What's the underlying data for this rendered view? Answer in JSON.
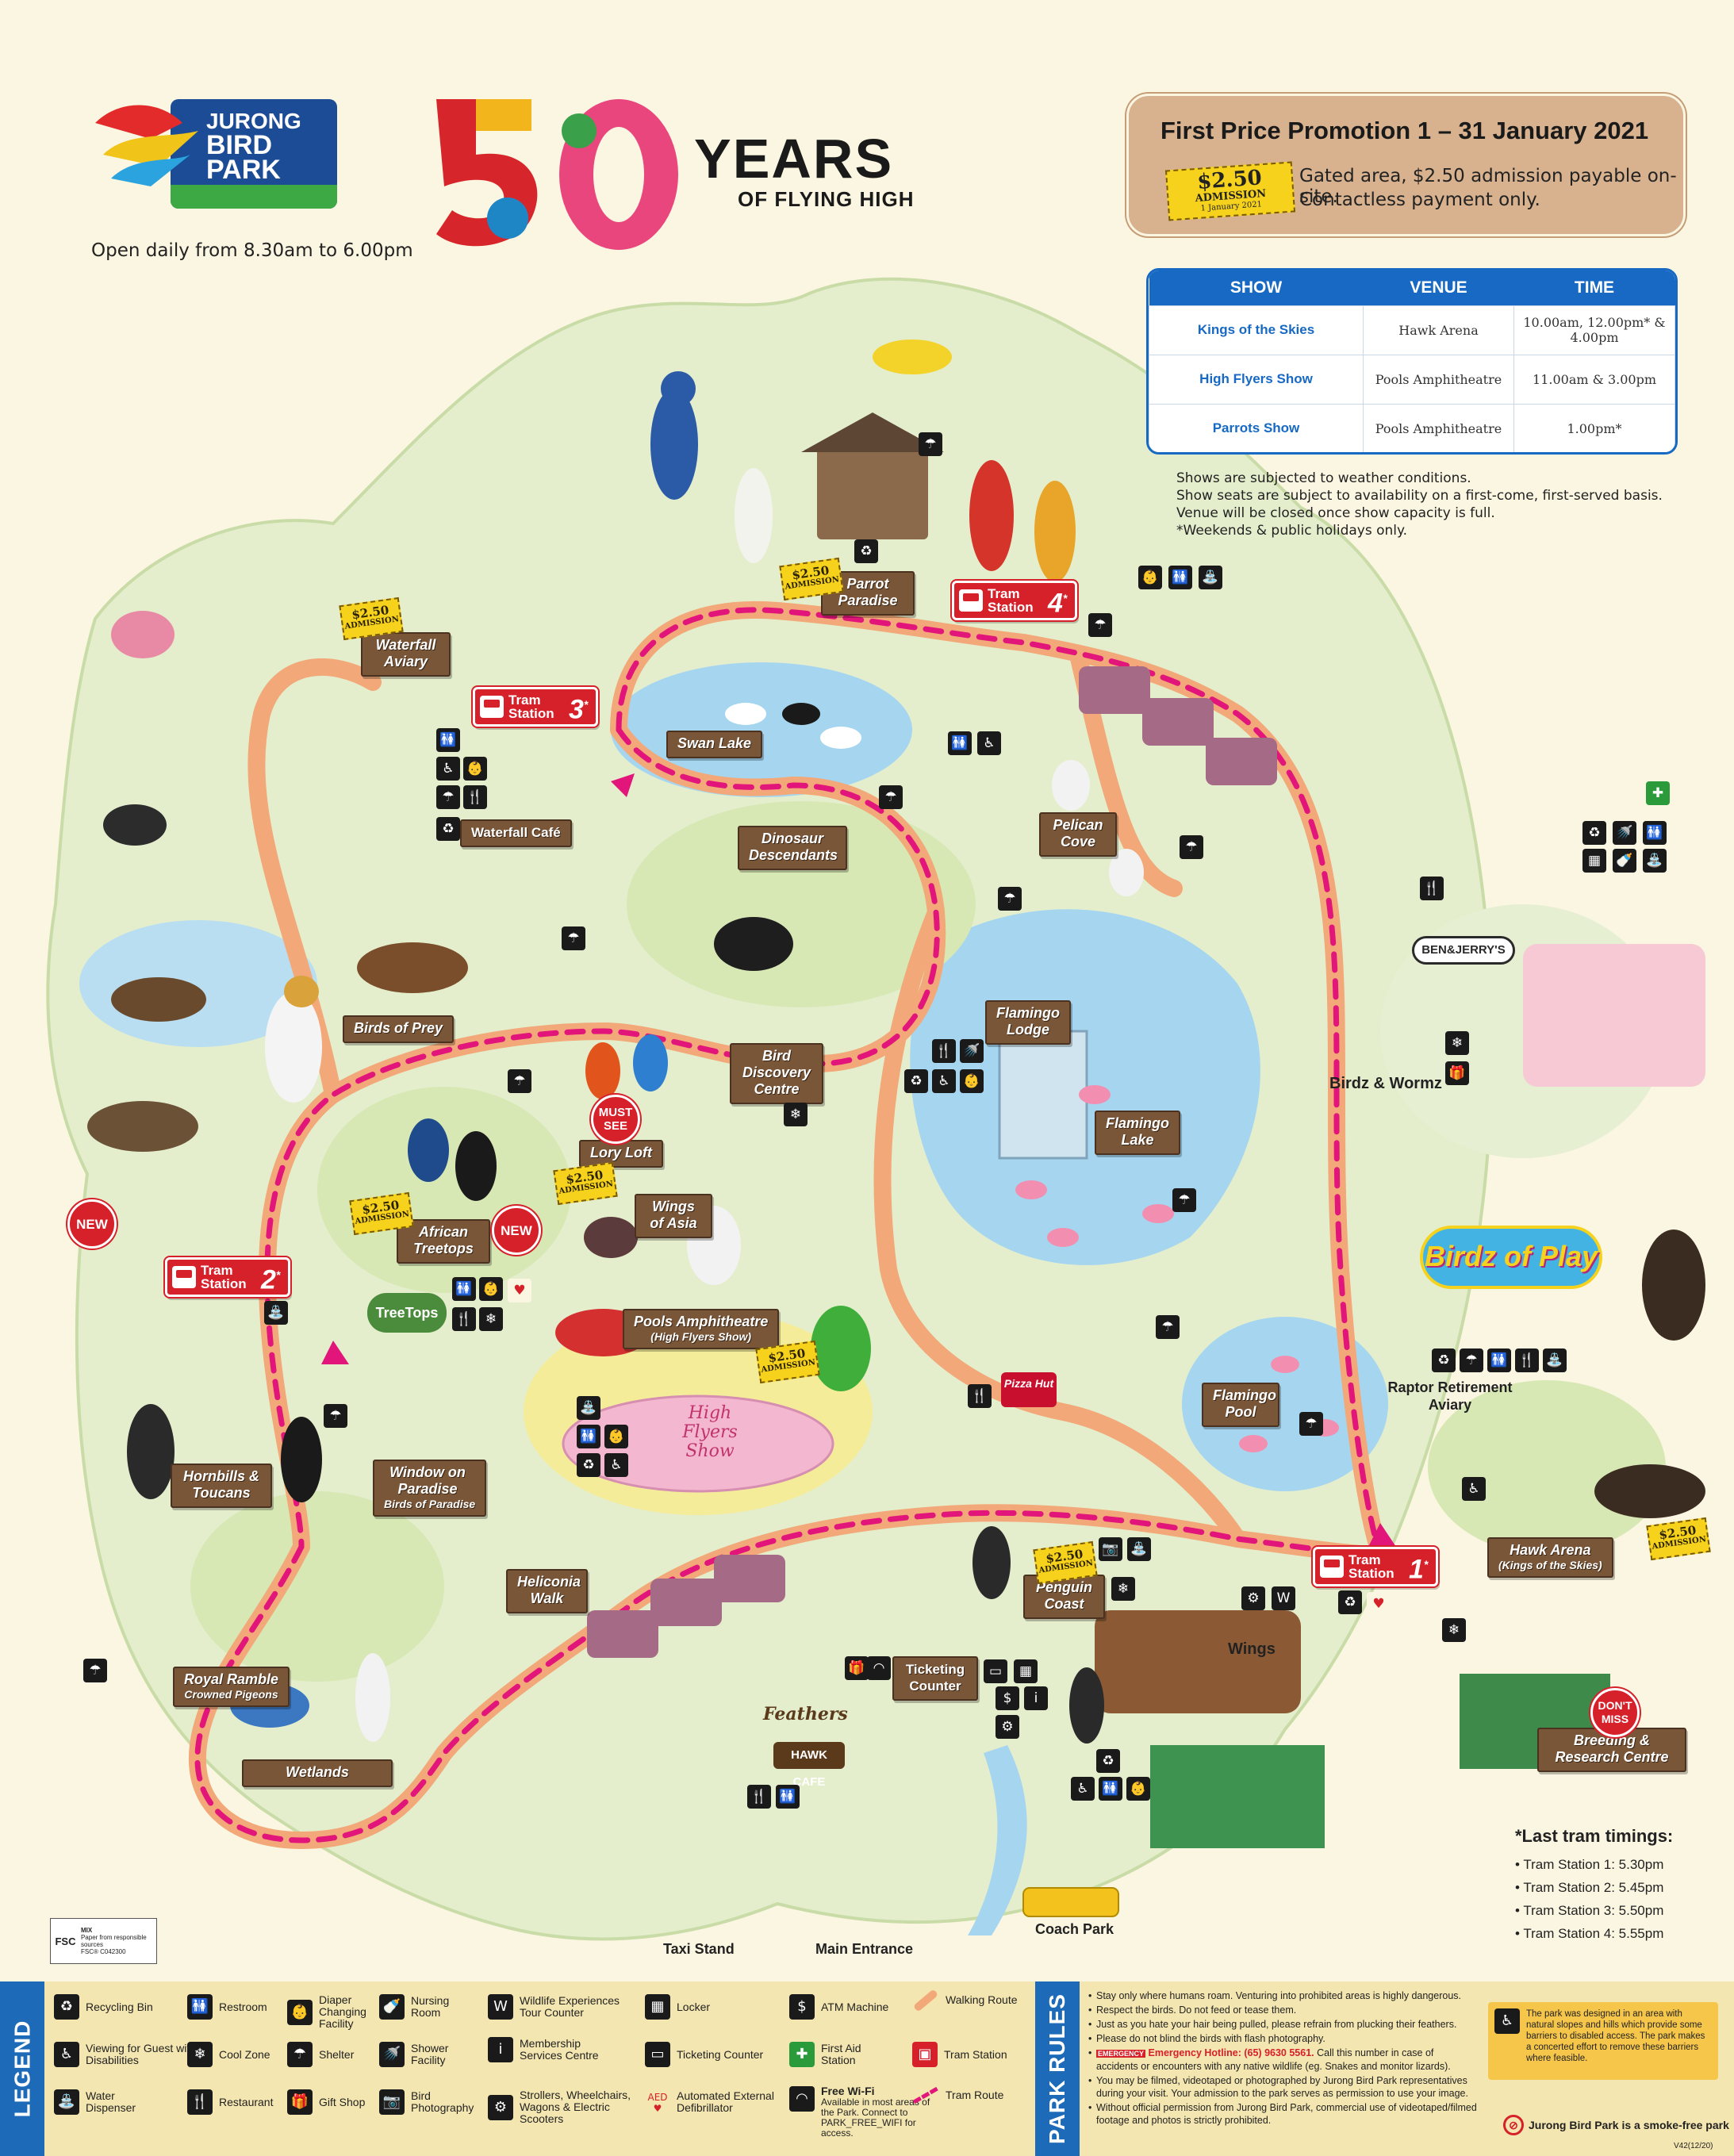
{
  "header": {
    "logo_lines": [
      "JURONG",
      "BIRD",
      "PARK"
    ],
    "hours": "Open daily from 8.30am to 6.00pm",
    "anniv_years": "YEARS",
    "anniv_tagline": "OF FLYING HIGH"
  },
  "promo": {
    "title": "First Price Promotion 1 – 31 January 2021",
    "ticket_price": "$2.50",
    "ticket_word": "ADMISSION",
    "ticket_date": "1 January 2021",
    "line1": "Gated area, $2.50 admission payable on-site.",
    "line2": "Contactless payment only."
  },
  "shows": {
    "headers": [
      "SHOW",
      "VENUE",
      "TIME"
    ],
    "rows": [
      {
        "show": "Kings of the Skies",
        "venue": "Hawk Arena",
        "time": "10.00am, 12.00pm* & 4.00pm"
      },
      {
        "show": "High Flyers Show",
        "venue": "Pools Amphitheatre",
        "time": "11.00am & 3.00pm"
      },
      {
        "show": "Parrots Show",
        "venue": "Pools Amphitheatre",
        "time": "1.00pm*"
      }
    ],
    "notes": [
      "Shows are subjected to weather conditions.",
      "Show seats are subject to availability on a first-come, first-served basis.",
      "Venue will be closed once show capacity is full.",
      "*Weekends & public holidays only."
    ]
  },
  "areas": {
    "parrot_paradise": "Parrot Paradise",
    "waterfall_aviary": "Waterfall Aviary",
    "swan_lake": "Swan Lake",
    "waterfall_cafe": "Waterfall Café",
    "dinosaur_descendants": "Dinosaur Descendants",
    "pelican_cove": "Pelican Cove",
    "birds_of_prey": "Birds of Prey",
    "flamingo_lodge": "Flamingo Lodge",
    "bird_discovery_centre": "Bird Discovery Centre",
    "lory_loft": "Lory Loft",
    "flamingo_lake": "Flamingo Lake",
    "wings_of_asia": "Wings of Asia",
    "african_treetops": "African Treetops",
    "pools_amphitheatre": "Pools Amphitheatre",
    "pools_amphitheatre_sub": "(High Flyers Show)",
    "flamingo_pool": "Flamingo Pool",
    "raptor_retirement_aviary": "Raptor Retirement Aviary",
    "hornbills_toucans": "Hornbills & Toucans",
    "window_on_paradise": "Window on Paradise",
    "window_on_paradise_sub": "Birds of Paradise",
    "heliconia_walk": "Heliconia Walk",
    "penguin_coast": "Penguin Coast",
    "hawk_arena": "Hawk Arena",
    "hawk_arena_sub": "(Kings of the Skies)",
    "royal_ramble": "Royal Ramble",
    "royal_ramble_sub": "Crowned Pigeons",
    "wetlands": "Wetlands",
    "wings": "Wings",
    "ticketing_counter": "Ticketing Counter",
    "breeding_research_centre": "Breeding & Research Centre",
    "birdz_wormz": "Birdz & Wormz",
    "birdz_of_play": "Birdz of Play",
    "taxi_stand": "Taxi Stand",
    "main_entrance": "Main Entrance",
    "coach_park": "Coach Park",
    "treetops_cafe": "TreeTops",
    "hawk_cafe": "HAWK CAFE",
    "feathers": "Feathers",
    "ben_jerrys": "BEN&JERRY'S",
    "pizza_hut": "Pizza Hut",
    "high_flyers_logo": "High Flyers Show"
  },
  "trams": {
    "label": "Tram Station",
    "stations": [
      "1",
      "2",
      "3",
      "4"
    ],
    "asterisk": "*"
  },
  "badges": {
    "new": "NEW",
    "must_see": "MUST SEE",
    "dont_miss": "DON'T MISS"
  },
  "ticket_badge": {
    "price": "$2.50",
    "word": "ADMISSION"
  },
  "last_tram": {
    "title": "*Last tram timings:",
    "items": [
      "Tram Station 1: 5.30pm",
      "Tram Station 2: 5.45pm",
      "Tram Station 3: 5.50pm",
      "Tram Station 4: 5.55pm"
    ]
  },
  "fsc": {
    "mix": "MIX",
    "paper": "Paper from responsible sources",
    "code": "FSC® C042300",
    "logo": "FSC"
  },
  "legend": {
    "title": "LEGEND",
    "items": [
      {
        "icon": "recycle-icon",
        "glyph": "♻",
        "label": "Recycling Bin"
      },
      {
        "icon": "accessible-icon",
        "glyph": "♿",
        "label": "Viewing for Guest with Disabilities"
      },
      {
        "icon": "water-icon",
        "glyph": "⛲",
        "label": "Water Dispenser"
      },
      {
        "icon": "restroom-icon",
        "glyph": "🚻",
        "label": "Restroom"
      },
      {
        "icon": "snowflake-icon",
        "glyph": "❄",
        "label": "Cool Zone"
      },
      {
        "icon": "restaurant-icon",
        "glyph": "🍴",
        "label": "Restaurant"
      },
      {
        "icon": "baby-icon",
        "glyph": "👶",
        "label": "Diaper Changing Facility"
      },
      {
        "icon": "umbrella-icon",
        "glyph": "☂",
        "label": "Shelter"
      },
      {
        "icon": "gift-icon",
        "glyph": "🎁",
        "label": "Gift Shop"
      },
      {
        "icon": "bottle-icon",
        "glyph": "🍼",
        "label": "Nursing Room"
      },
      {
        "icon": "shower-icon",
        "glyph": "🚿",
        "label": "Shower Facility"
      },
      {
        "icon": "camera-icon",
        "glyph": "📷",
        "label": "Bird Photography"
      },
      {
        "icon": "wildlife-icon",
        "glyph": "W",
        "label": "Wildlife Experiences Tour Counter"
      },
      {
        "icon": "info-icon",
        "glyph": "i",
        "label": "Membership Services Centre"
      },
      {
        "icon": "stroller-icon",
        "glyph": "⚙",
        "label": "Strollers, Wheelchairs, Wagons & Electric Scooters"
      },
      {
        "icon": "locker-icon",
        "glyph": "▦",
        "label": "Locker"
      },
      {
        "icon": "ticket-icon",
        "glyph": "▭",
        "label": "Ticketing Counter"
      },
      {
        "icon": "aed-icon",
        "glyph": "♥",
        "label": "Automated External Defibrillator"
      },
      {
        "icon": "atm-icon",
        "glyph": "$",
        "label": "ATM Machine"
      },
      {
        "icon": "first-aid-icon",
        "glyph": "✚",
        "label": "First Aid Station"
      },
      {
        "icon": "wifi-icon",
        "glyph": "◠",
        "label": "Free Wi-Fi"
      },
      {
        "icon": "walking-route-icon",
        "glyph": "",
        "label": "Walking Route"
      },
      {
        "icon": "tram-station-icon",
        "glyph": "",
        "label": "Tram Station"
      },
      {
        "icon": "tram-route-icon",
        "glyph": "",
        "label": "Tram Route"
      }
    ],
    "wifi_note": "Available in most areas of the Park. Connect to PARK_FREE_WIFI for access.",
    "aed_short": "AED"
  },
  "park_rules": {
    "title": "PARK RULES",
    "items": [
      "Stay only where humans roam. Venturing into prohibited areas is highly dangerous.",
      "Respect the birds. Do not feed or tease them.",
      "Just as you hate your hair being pulled, please refrain from plucking their feathers.",
      "Please do not blind the birds with flash photography."
    ],
    "emergency_label": "EMERGENCY",
    "emergency": "Emergency Hotline: (65) 9630 5561.",
    "emergency_rest": "Call this number in case of accidents or encounters with any native wildlife (eg. Snakes and monitor lizards).",
    "filmed": "You may be filmed, videotaped or photographed by Jurong Bird Park representatives during your visit. Your admission to the park serves as permission to use your image.",
    "commercial": "Without official permission from Jurong Bird Park, commercial use of videotaped/filmed footage and photos is strictly prohibited.",
    "accessibility": "The park was designed in an area with natural slopes and hills which provide some barriers to disabled access. The park makes a concerted effort to remove these barriers where feasible.",
    "smoke_free": "Jurong Bird Park is a smoke-free park",
    "version": "V42(12/20)"
  },
  "colors": {
    "walking_route": "#f2a878",
    "tram_route": "#e2157a",
    "legend_blue": "#1d6bb8",
    "sign_brown": "#7a5638",
    "tram_red": "#d6202a",
    "water": "#9fd2ee",
    "grass": "#cfe3a4"
  }
}
